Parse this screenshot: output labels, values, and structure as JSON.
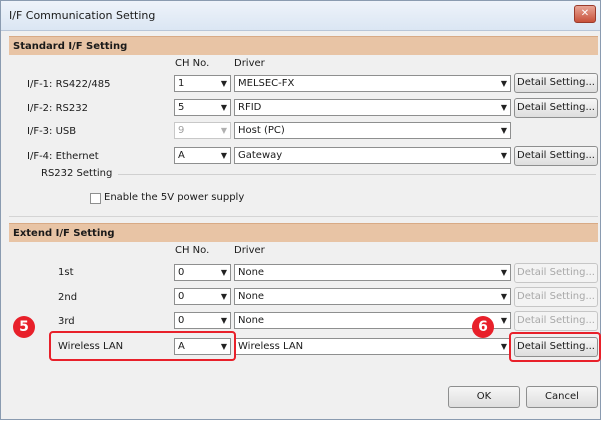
{
  "window": {
    "title": "I/F Communication Setting",
    "close_label": "✕"
  },
  "standard": {
    "header": "Standard I/F Setting",
    "col_ch": "CH No.",
    "col_driver": "Driver",
    "rows": [
      {
        "label": "I/F-1:  RS422/485",
        "ch": "1",
        "driver": "MELSEC-FX",
        "detail": "Detail Setting..."
      },
      {
        "label": "I/F-2:  RS232",
        "ch": "5",
        "driver": "RFID",
        "detail": "Detail Setting..."
      },
      {
        "label": "I/F-3:  USB",
        "ch": "9",
        "driver": "Host (PC)"
      },
      {
        "label": "I/F-4:  Ethernet",
        "ch": "A",
        "driver": "Gateway",
        "detail": "Detail Setting..."
      }
    ],
    "rs232_setting_label": "RS232 Setting",
    "enable_5v_label": "Enable the 5V power supply"
  },
  "extend": {
    "header": "Extend I/F Setting",
    "col_ch": "CH No.",
    "col_driver": "Driver",
    "rows": [
      {
        "label": "1st",
        "ch": "0",
        "driver": "None",
        "detail": "Detail Setting..."
      },
      {
        "label": "2nd",
        "ch": "0",
        "driver": "None",
        "detail": "Detail Setting..."
      },
      {
        "label": "3rd",
        "ch": "0",
        "driver": "None",
        "detail": "Detail Setting..."
      },
      {
        "label": "Wireless LAN",
        "ch": "A",
        "driver": "Wireless LAN",
        "detail": "Detail Setting..."
      }
    ]
  },
  "callouts": {
    "five": "5",
    "six": "6"
  },
  "footer": {
    "ok": "OK",
    "cancel": "Cancel"
  },
  "colors": {
    "section_header": "#e8c4a5",
    "callout": "#e8202a"
  }
}
